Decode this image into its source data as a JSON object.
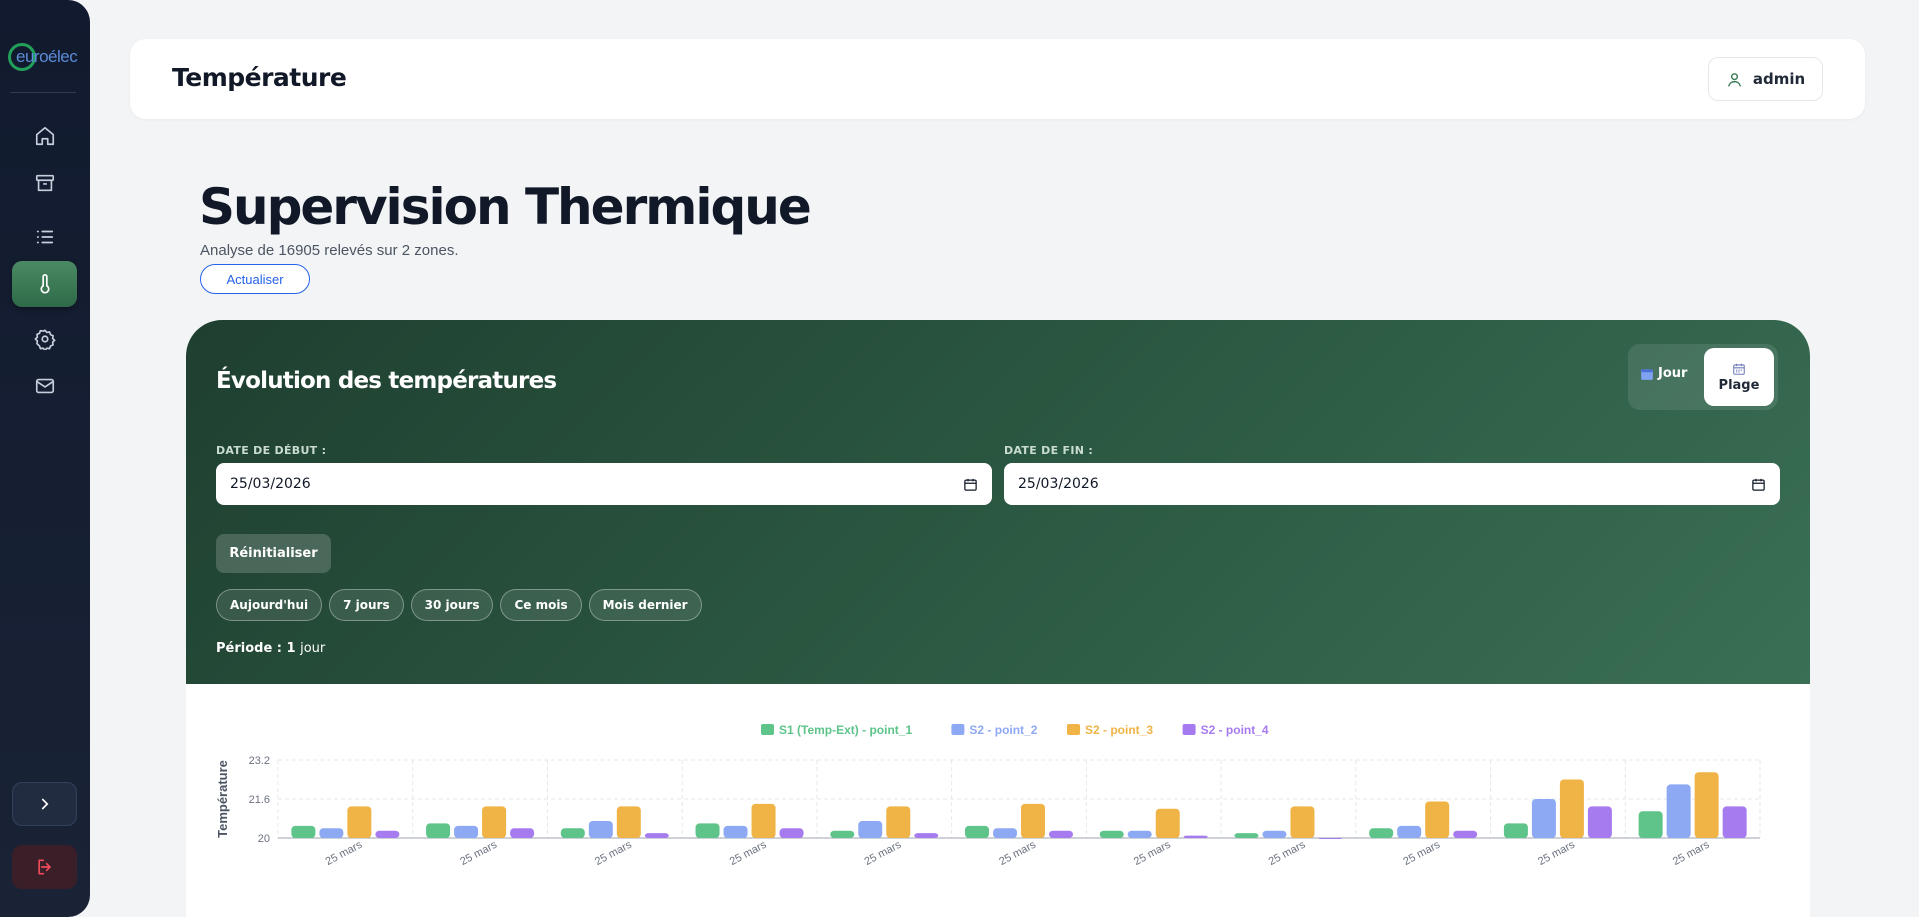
{
  "brand": {
    "name": "euroélec",
    "color": "#22a05a"
  },
  "sidebar": {
    "items": [
      {
        "icon": "home-icon",
        "label": "Accueil"
      },
      {
        "icon": "archive-icon",
        "label": "Archives"
      },
      {
        "icon": "list-icon",
        "label": "Liste"
      },
      {
        "icon": "thermometer-icon",
        "label": "Température",
        "active": true
      },
      {
        "icon": "gear-icon",
        "label": "Paramètres"
      },
      {
        "icon": "mail-icon",
        "label": "Messages"
      }
    ]
  },
  "header": {
    "title": "Température",
    "user": "admin"
  },
  "main": {
    "title": "Supervision Thermique",
    "subtitle": "Analyse de 16905 relevés sur 2 zones.",
    "refresh_label": "Actualiser"
  },
  "panel": {
    "title": "Évolution des températures",
    "mode_day": "Jour",
    "mode_range": "Plage",
    "start_label": "DATE DE DÉBUT :",
    "start_value": "25/03/2026",
    "end_label": "DATE DE FIN :",
    "end_value": "25/03/2026",
    "reset_label": "Réinitialiser",
    "quick": [
      "Aujourd'hui",
      "7 jours",
      "30 jours",
      "Ce mois",
      "Mois dernier"
    ],
    "periode_label": "Période :",
    "periode_value": "1",
    "periode_unit": "jour"
  },
  "chart_data": {
    "type": "bar",
    "ylabel": "Température",
    "ylim": [
      20,
      23.2
    ],
    "yticks": [
      20,
      21.6,
      23.2
    ],
    "categories": [
      "25 mars",
      "25 mars",
      "25 mars",
      "25 mars",
      "25 mars",
      "25 mars",
      "25 mars",
      "25 mars",
      "25 mars",
      "25 mars",
      "25 mars"
    ],
    "series": [
      {
        "name": "S1 (Temp-Ext) - point_1",
        "color": "#5ec48a",
        "values": [
          20.5,
          20.6,
          20.4,
          20.6,
          20.3,
          20.5,
          20.3,
          20.2,
          20.4,
          20.6,
          21.1
        ]
      },
      {
        "name": "S2 - point_2",
        "color": "#8ea9f4",
        "values": [
          20.4,
          20.5,
          20.7,
          20.5,
          20.7,
          20.4,
          20.3,
          20.3,
          20.5,
          21.6,
          22.2
        ]
      },
      {
        "name": "S2 - point_3",
        "color": "#f0b446",
        "values": [
          21.3,
          21.3,
          21.3,
          21.4,
          21.3,
          21.4,
          21.2,
          21.3,
          21.5,
          22.4,
          22.7
        ]
      },
      {
        "name": "S2 - point_4",
        "color": "#a77bf0",
        "values": [
          20.3,
          20.4,
          20.2,
          20.4,
          20.2,
          20.3,
          20.1,
          20.0,
          20.3,
          21.3,
          21.3
        ]
      }
    ]
  }
}
